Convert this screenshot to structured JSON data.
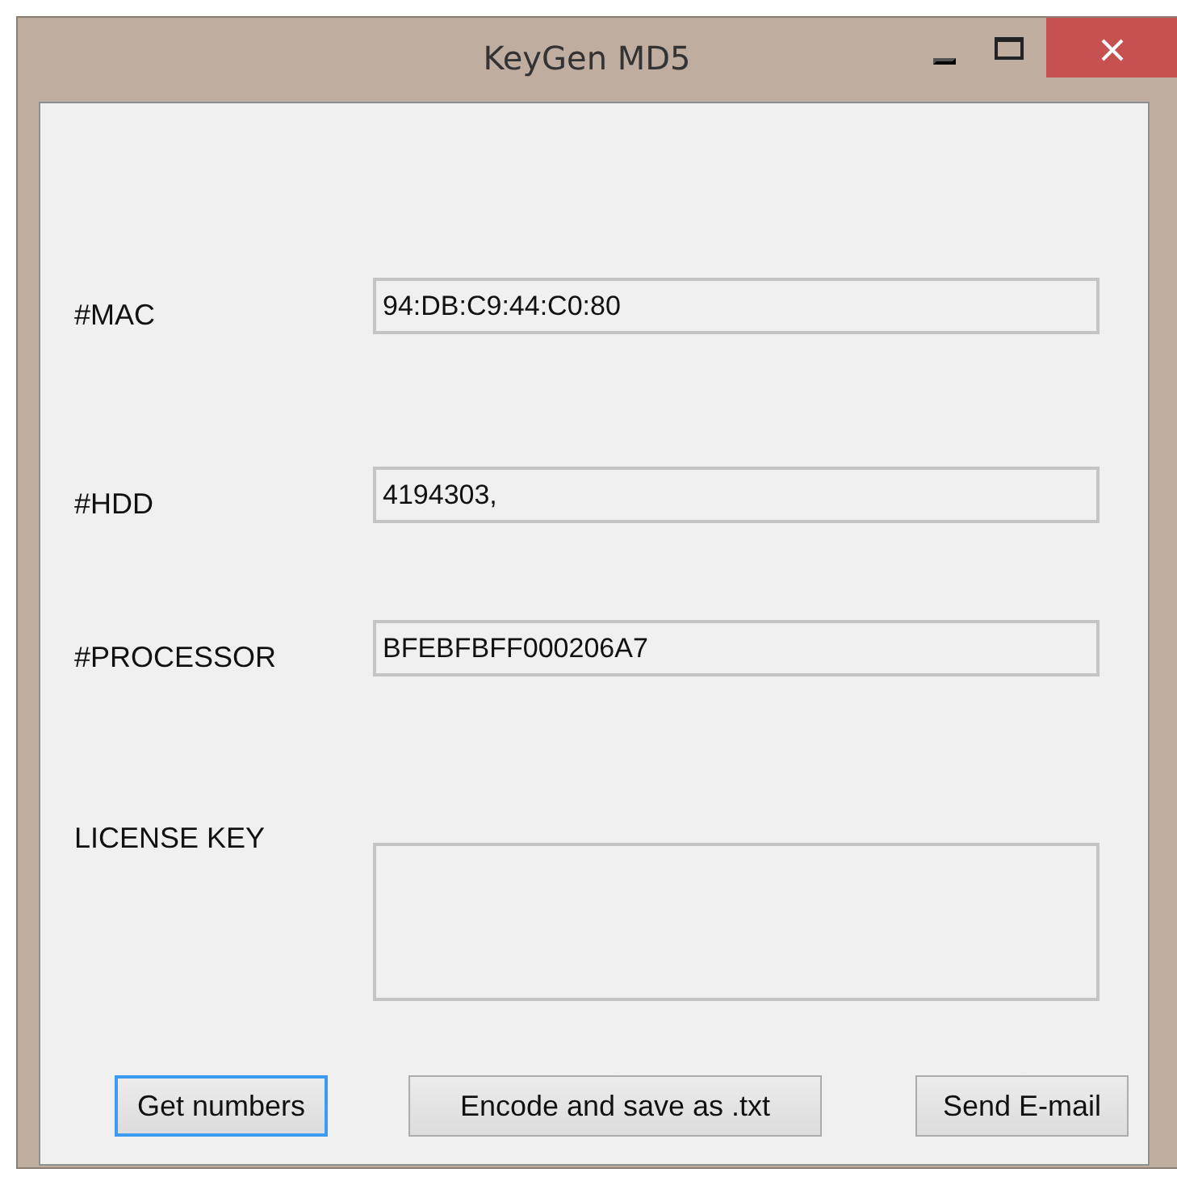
{
  "window": {
    "title": "KeyGen MD5"
  },
  "fields": [
    {
      "kind": "line",
      "label": "#MAC",
      "value": "94:DB:C9:44:C0:80"
    },
    {
      "kind": "line",
      "label": "#HDD",
      "value": "4194303,"
    },
    {
      "kind": "line",
      "label": "#PROCESSOR",
      "value": "BFEBFBFF000206A7"
    },
    {
      "kind": "multiline",
      "label": "LICENSE KEY"
    }
  ],
  "buttons": [
    {
      "label": "Get numbers",
      "focused": true
    },
    {
      "label": "Encode and save as .txt",
      "focused": false
    },
    {
      "label": "Send E-mail",
      "focused": false
    }
  ]
}
